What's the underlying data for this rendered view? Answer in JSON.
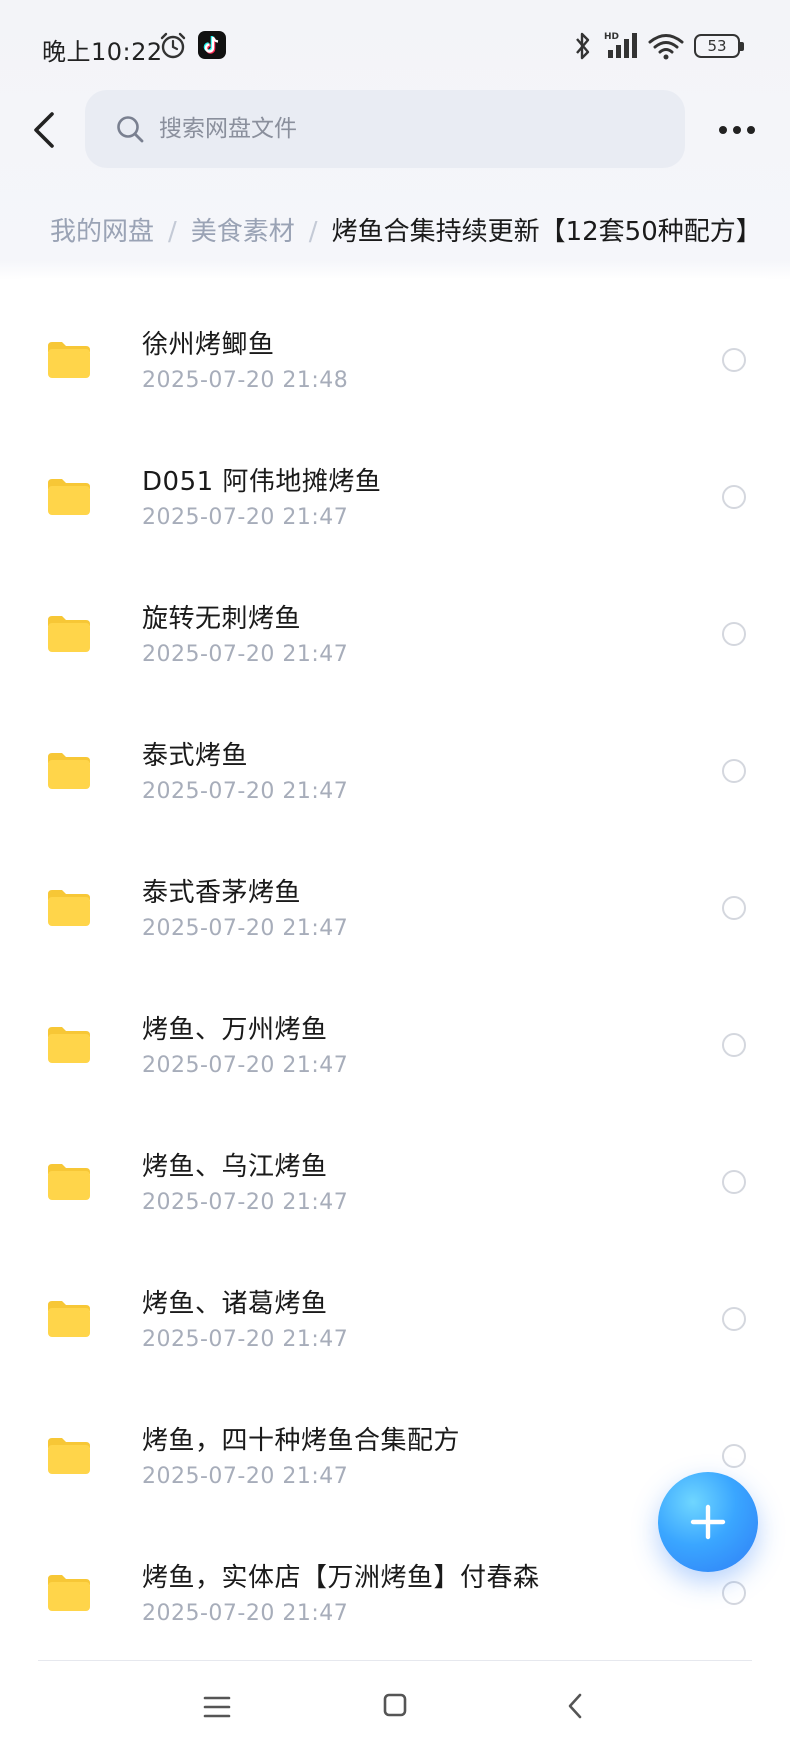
{
  "status_bar": {
    "time": "晚上10:22",
    "battery_level": "53",
    "network_label": "HD",
    "icons": [
      "alarm-icon",
      "tiktok-icon",
      "bluetooth-icon",
      "signal-icon",
      "wifi-icon",
      "battery-icon"
    ]
  },
  "header": {
    "search_placeholder": "搜索网盘文件",
    "icons": [
      "back-arrow-icon",
      "search-icon",
      "more-dots-icon"
    ]
  },
  "breadcrumb": {
    "items": [
      "我的网盘",
      "美食素材"
    ],
    "separator": "/",
    "current": "烤鱼合集持续更新【12套50种配方】"
  },
  "files": [
    {
      "name": "徐州烤鲫鱼",
      "date": "2025-07-20  21:48"
    },
    {
      "name": "D051  阿伟地摊烤鱼",
      "date": "2025-07-20  21:47"
    },
    {
      "name": "旋转无刺烤鱼",
      "date": "2025-07-20  21:47"
    },
    {
      "name": "泰式烤鱼",
      "date": "2025-07-20  21:47"
    },
    {
      "name": "泰式香茅烤鱼",
      "date": "2025-07-20  21:47"
    },
    {
      "name": "烤鱼、万州烤鱼",
      "date": "2025-07-20  21:47"
    },
    {
      "name": "烤鱼、乌江烤鱼",
      "date": "2025-07-20  21:47"
    },
    {
      "name": "烤鱼、诸葛烤鱼",
      "date": "2025-07-20  21:47"
    },
    {
      "name": "烤鱼，四十种烤鱼合集配方",
      "date": "2025-07-20  21:47"
    },
    {
      "name": "烤鱼，实体店【万洲烤鱼】付春森",
      "date": "2025-07-20  21:47"
    }
  ],
  "colors": {
    "folder": "#ffd54a",
    "folder_tab": "#f7c736",
    "fab_blue": "#2f7df6",
    "muted_text": "#a7adba",
    "search_bg": "#e9ecf3"
  },
  "fab": {
    "icon": "plus-icon"
  },
  "nav_bar": {
    "icons": [
      "menu-icon",
      "home-square-icon",
      "back-chevron-icon"
    ]
  }
}
